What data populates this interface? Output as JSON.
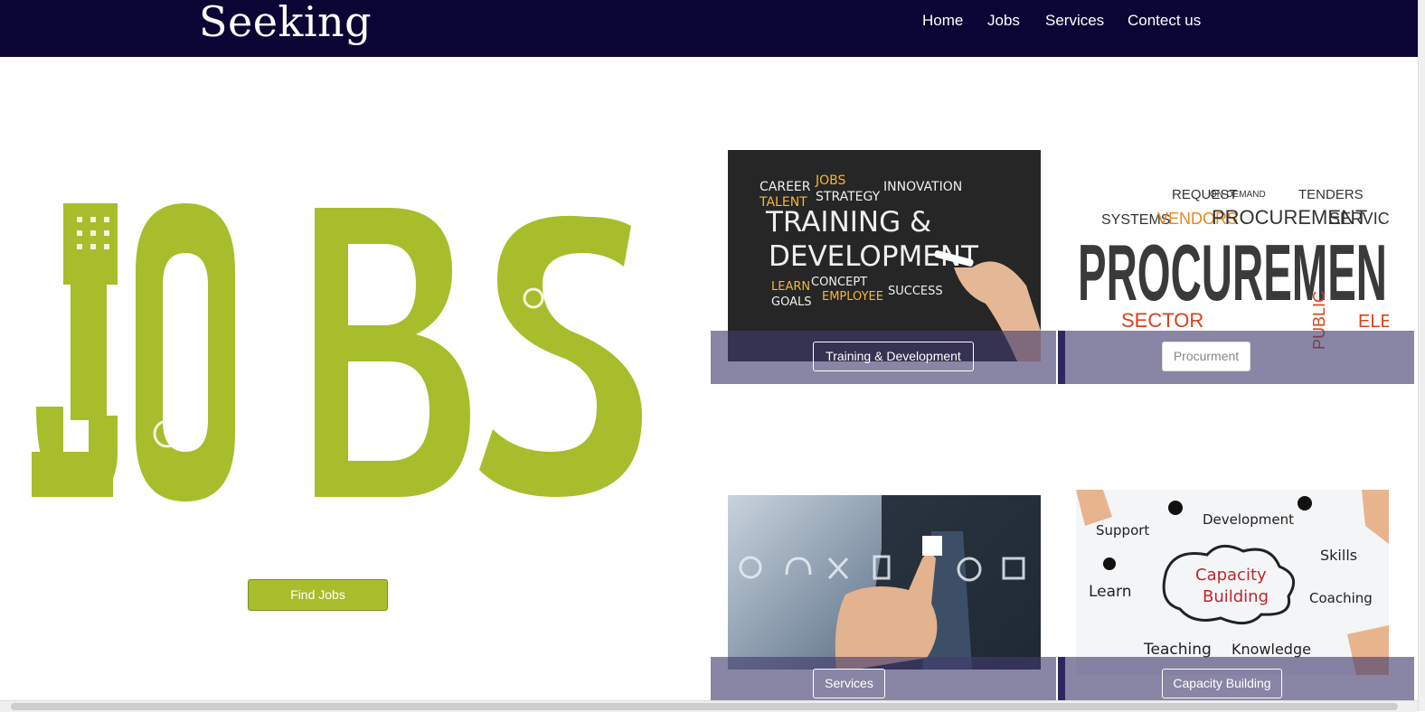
{
  "brand": {
    "name": "Seeking"
  },
  "nav": {
    "home": "Home",
    "jobs": "Jobs",
    "services": "Services",
    "contact": "Contect us"
  },
  "hero": {
    "find_jobs_label": "Find Jobs",
    "art_word": "JOBS",
    "art_color": "#a8bd2b"
  },
  "cards": [
    {
      "label": "Training & Development",
      "image_text": {
        "line1": "CAREER",
        "line1b": "JOBS",
        "line2": "TALENT",
        "line2b": "STRATEGY",
        "line2c": "INNOVATION",
        "headline1": "TRAINING &",
        "headline2": "DEVELOPMENT",
        "line3": "LEARN",
        "line3b": "CONCEPT",
        "line4": "GOALS",
        "line4b": "EMPLOYEE",
        "line4c": "SUCCESS"
      }
    },
    {
      "label": "Procurment",
      "image_text": {
        "big": "PROCUREMEN",
        "mid1": "SYSTEMS",
        "mid2": "VENDORS",
        "mid3": "PROCUREMENT",
        "mid4": "SERVICES",
        "top1": "REQUEST",
        "top2": "ON-DEMAND",
        "top3": "TENDERS",
        "bottom1": "SECTOR",
        "bottom2": "PUBLIC",
        "bottom3": "ELECTI"
      }
    },
    {
      "label": "Services",
      "image_text": {}
    },
    {
      "label": "Capacity Building",
      "image_text": {
        "center1": "Capacity",
        "center2": "Building",
        "w1": "Support",
        "w2": "Development",
        "w3": "Skills",
        "w4": "Learn",
        "w5": "Coaching",
        "w6": "Teaching",
        "w7": "Knowledge"
      }
    }
  ],
  "colors": {
    "navbar": "#0b0536",
    "accent": "#a8bd2b",
    "overlay": "#403a6e"
  }
}
